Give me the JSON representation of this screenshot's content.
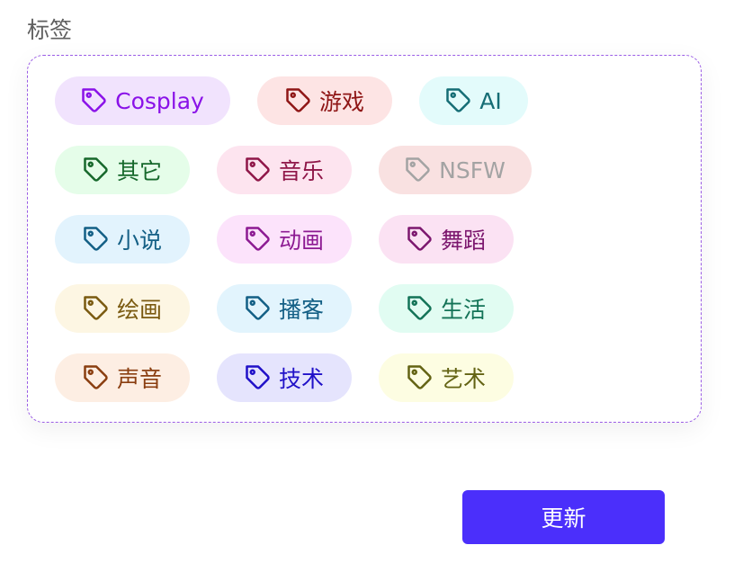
{
  "form": {
    "tags_label": "标签",
    "submit_label": "更新"
  },
  "tags": [
    {
      "label": "Cosplay",
      "bg": "#f1e3fd",
      "fg": "#8a12e8"
    },
    {
      "label": "游戏",
      "bg": "#fde4e4",
      "fg": "#8f1616"
    },
    {
      "label": "AI",
      "bg": "#e3fbfb",
      "fg": "#156d75"
    },
    {
      "label": "其它",
      "bg": "#e5fde9",
      "fg": "#16682b"
    },
    {
      "label": "音乐",
      "bg": "#fde4ef",
      "fg": "#8f1648"
    },
    {
      "label": "NSFW",
      "bg": "#f9e1e1",
      "fg": "#a3a3a3"
    },
    {
      "label": "小说",
      "bg": "#e2f3fd",
      "fg": "#135f85"
    },
    {
      "label": "动画",
      "bg": "#fce3fb",
      "fg": "#8c1a92"
    },
    {
      "label": "舞蹈",
      "bg": "#fbe2f3",
      "fg": "#7c176e"
    },
    {
      "label": "绘画",
      "bg": "#fdf6e3",
      "fg": "#7a5a10"
    },
    {
      "label": "播客",
      "bg": "#e2f4fd",
      "fg": "#135f85"
    },
    {
      "label": "生活",
      "bg": "#e1fcf2",
      "fg": "#137357"
    },
    {
      "label": "声音",
      "bg": "#fdeee3",
      "fg": "#8a3e10"
    },
    {
      "label": "技术",
      "bg": "#e5e4fd",
      "fg": "#2011c8"
    },
    {
      "label": "艺术",
      "bg": "#fdfde2",
      "fg": "#636313"
    }
  ]
}
